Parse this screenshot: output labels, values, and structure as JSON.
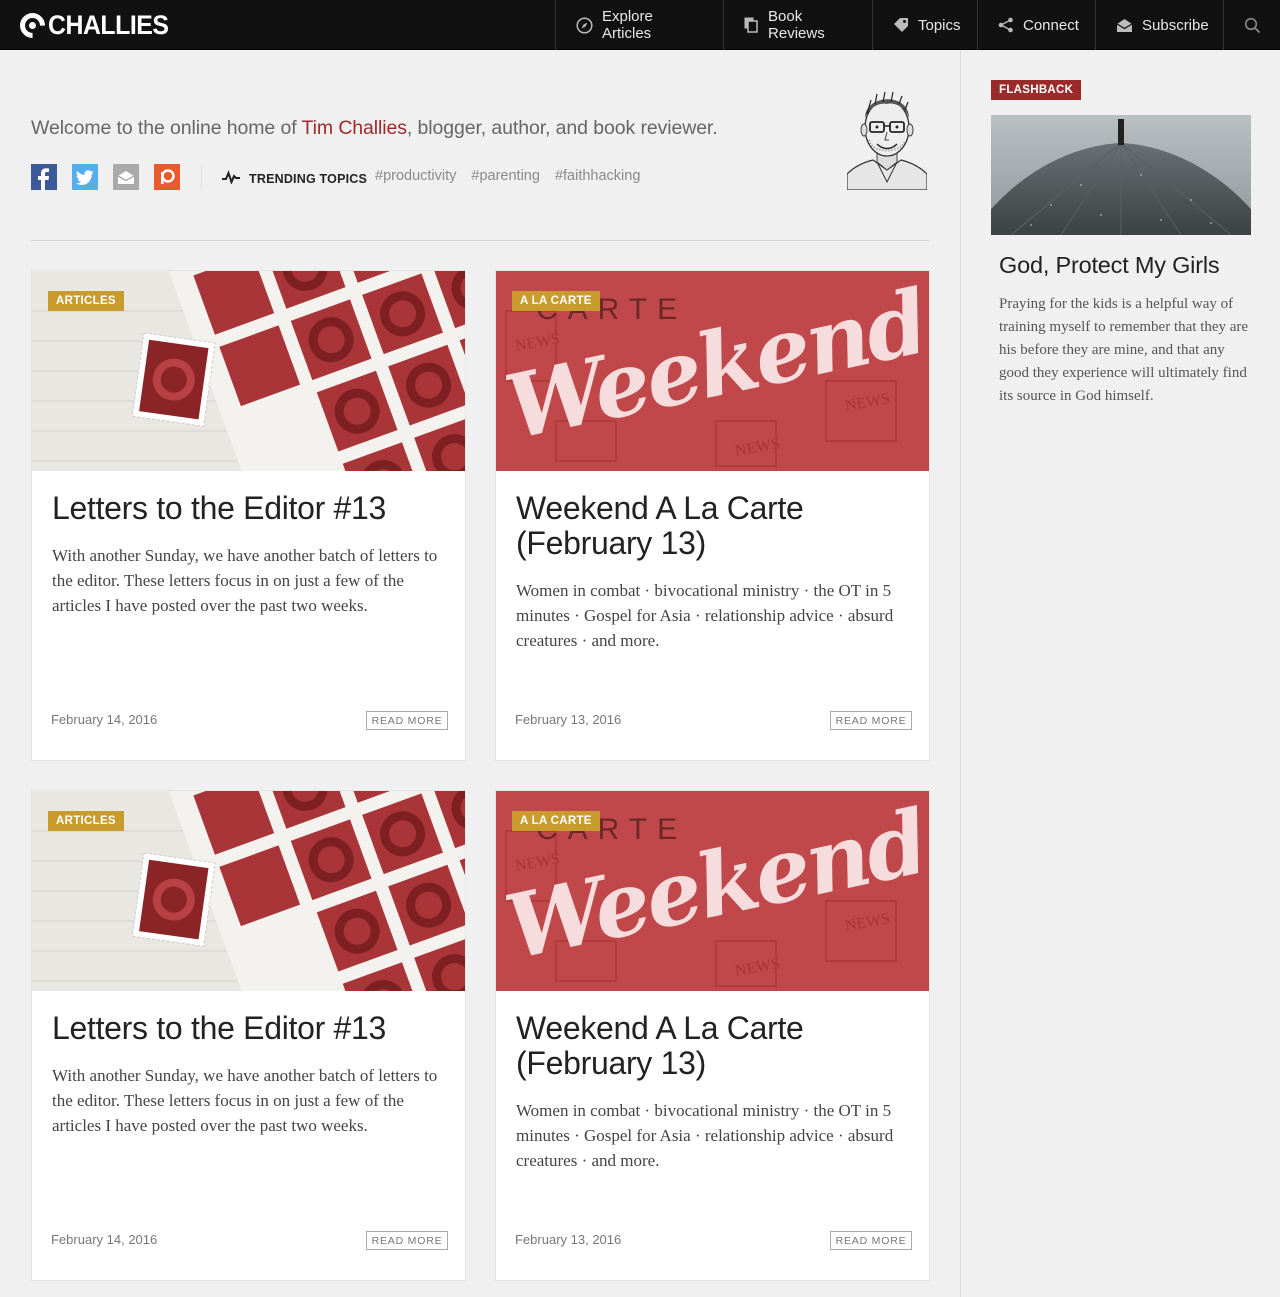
{
  "brand": {
    "name": "CHALLIES"
  },
  "nav": {
    "items": [
      {
        "label": "Explore Articles",
        "icon": "compass-icon"
      },
      {
        "label": "Book Reviews",
        "icon": "books-icon"
      },
      {
        "label": "Topics",
        "icon": "tag-icon"
      },
      {
        "label": "Connect",
        "icon": "share-icon"
      },
      {
        "label": "Subscribe",
        "icon": "envelope-icon"
      }
    ],
    "search_icon": "search-icon"
  },
  "intro": {
    "welcome_prefix": "Welcome to the online home of ",
    "welcome_name": "Tim Challies",
    "welcome_suffix": ", blogger, author, and book reviewer.",
    "social": [
      "facebook-icon",
      "twitter-icon",
      "email-icon",
      "patreon-icon"
    ],
    "trending_label": "TRENDING TOPICS",
    "tags": [
      "#productivity",
      "#parenting",
      "#faithhacking"
    ]
  },
  "cards": [
    {
      "badge": "ARTICLES",
      "image_words": [],
      "title": "Letters to the Editor #13",
      "excerpt": "With another Sunday, we have another batch of letters to the editor. These letters focus in on just a few of the articles I have posted over the past two weeks.",
      "date": "February 14, 2016",
      "read_more": "READ MORE"
    },
    {
      "badge": "A LA CARTE",
      "image_words": [
        "CARTE",
        "Weekend",
        "NEWS"
      ],
      "title": "Weekend A La Carte (February 13)",
      "excerpt": "Women in combat · bivocational ministry · the OT in 5 minutes · Gospel for Asia · relationship advice · absurd creatures · and more.",
      "date": "February 13, 2016",
      "read_more": "READ MORE"
    },
    {
      "badge": "ARTICLES",
      "image_words": [],
      "title": "Letters to the Editor #13",
      "excerpt": "With another Sunday, we have another batch of letters to the editor. These letters focus in on just a few of the articles I have posted over the past two weeks.",
      "date": "February 14, 2016",
      "read_more": "READ MORE"
    },
    {
      "badge": "A LA CARTE",
      "image_words": [
        "CARTE",
        "Weekend",
        "NEWS"
      ],
      "title": "Weekend A La Carte (February 13)",
      "excerpt": "Women in combat · bivocational ministry · the OT in 5 minutes · Gospel for Asia · relationship advice · absurd creatures · and more.",
      "date": "February 13, 2016",
      "read_more": "READ MORE"
    }
  ],
  "sidebar": {
    "badge": "FLASHBACK",
    "title": "God, Protect My Girls",
    "text": "Praying for the kids is a helpful way of training myself to remember that they are his before they are mine, and that any good they experience will ultimately find its source in God himself."
  },
  "colors": {
    "topbar": "#111111",
    "accent_red": "#9b2a2a",
    "badge_gold": "#c99a2e",
    "weekend_red": "#c0484a"
  }
}
